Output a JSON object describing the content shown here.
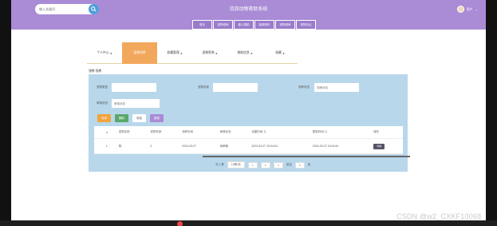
{
  "header": {
    "search_placeholder": "输入关键词",
    "site_title": "流浪动物救助系统",
    "user_name": "用户",
    "user_arrow": "⌄"
  },
  "topnav": [
    "首页",
    "宠物领养",
    "爱心捐助",
    "新闻资讯",
    "宠物领养",
    "宠物论坛"
  ],
  "tabs": [
    {
      "label": "个人中心",
      "active": false
    },
    {
      "label": "宠物领养",
      "active": true
    },
    {
      "label": "收藏管理",
      "active": false
    },
    {
      "label": "宠物寄养",
      "active": false
    },
    {
      "label": "救助信息",
      "active": false
    },
    {
      "label": "收藏",
      "active": false
    }
  ],
  "breadcrumb": "领养 领养",
  "filters": {
    "type_label": "宠物类型",
    "name_label": "宠物名称",
    "status_label": "领养状态",
    "status_placeholder": "领养状态",
    "review_label": "审核状态",
    "review_placeholder": "审核状态"
  },
  "buttons": {
    "search": "查询",
    "delete": "删除",
    "add": "添加",
    "export": "报表"
  },
  "table": {
    "headers": [
      "",
      "#",
      "宠物名称",
      "宠物年龄",
      "领养时间",
      "审核状态",
      "创建时间 ⇅",
      "更新时间 ⇅",
      "操作"
    ],
    "rows": [
      [
        "",
        "1",
        "狗",
        "2",
        "2024-03-07",
        "待审核",
        "2024-03-07 15:04:54",
        "2024-03-07 15:04:54",
        "详情"
      ]
    ]
  },
  "pager": {
    "total": "共 1 条",
    "per_page": "10条/页",
    "prev": "<",
    "page": "1",
    "next": ">",
    "goto": "前往",
    "goto_value": "1",
    "page_suffix": "页"
  },
  "watermark": "CSDN @w2_CXKF10068"
}
